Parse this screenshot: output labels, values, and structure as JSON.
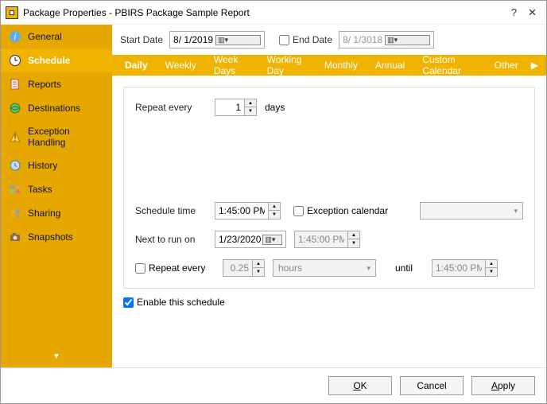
{
  "title": "Package Properties - PBIRS Package Sample Report",
  "sidebar": {
    "items": [
      {
        "label": "General"
      },
      {
        "label": "Schedule"
      },
      {
        "label": "Reports"
      },
      {
        "label": "Destinations"
      },
      {
        "label": "Exception Handling"
      },
      {
        "label": "History"
      },
      {
        "label": "Tasks"
      },
      {
        "label": "Sharing"
      },
      {
        "label": "Snapshots"
      }
    ],
    "active_index": 1
  },
  "date_row": {
    "start_label": "Start Date",
    "start_value": "8/ 1/2019",
    "end_label": "End Date",
    "end_checked": false,
    "end_value": "8/ 1/3018"
  },
  "tabs": {
    "items": [
      "Daily",
      "Weekly",
      "Week Days",
      "Working Day",
      "Monthly",
      "Annual",
      "Custom Calendar",
      "Other"
    ],
    "active_index": 0
  },
  "daily": {
    "repeat_every_label": "Repeat every",
    "repeat_value": "1",
    "repeat_unit": "days",
    "schedule_time_label": "Schedule time",
    "schedule_time_value": "1:45:00 PM",
    "exception_calendar_label": "Exception calendar",
    "exception_calendar_checked": false,
    "exception_calendar_value": "",
    "next_run_label": "Next to run on",
    "next_run_date": "1/23/2020",
    "next_run_time": "1:45:00 PM",
    "repeat2_label": "Repeat every",
    "repeat2_checked": false,
    "repeat2_value": "0.25",
    "repeat2_unit": "hours",
    "until_label": "until",
    "until_value": "1:45:00 PM",
    "enable_label": "Enable this schedule",
    "enable_checked": true
  },
  "buttons": {
    "ok": "OK",
    "cancel": "Cancel",
    "apply": "Apply"
  }
}
